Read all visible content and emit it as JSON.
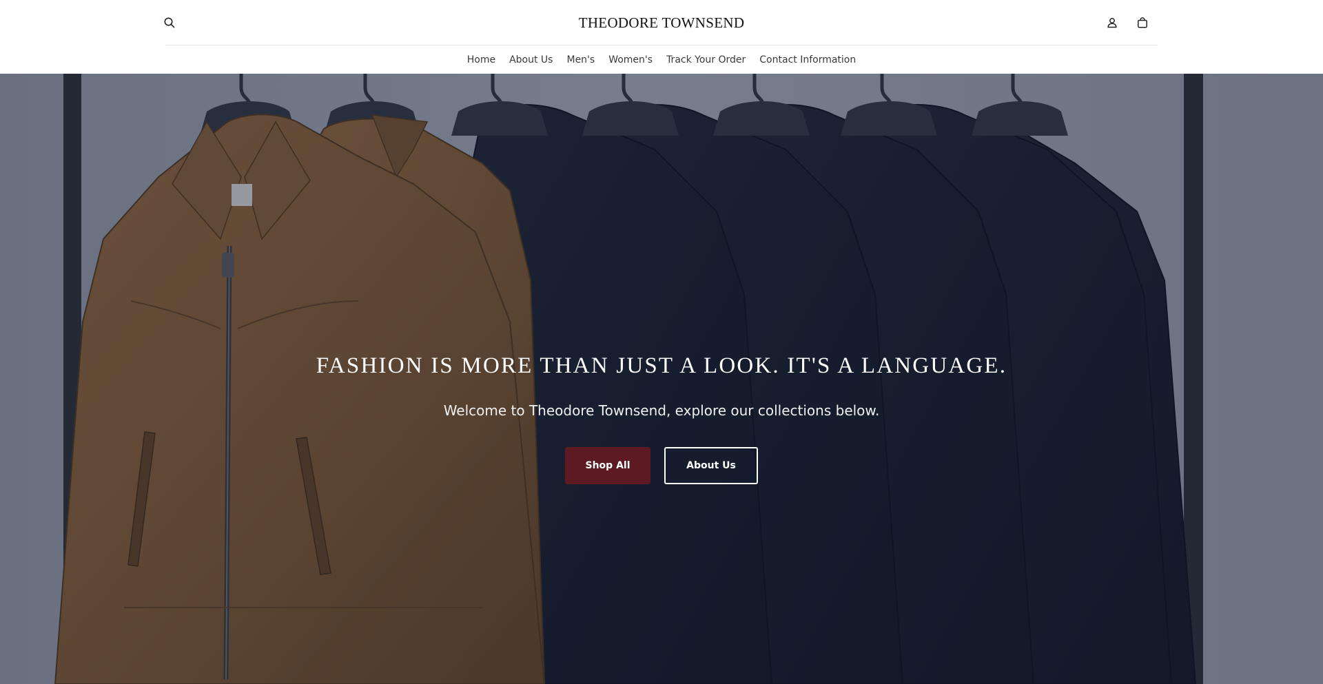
{
  "brand": {
    "name": "THEODORE TOWNSEND"
  },
  "header": {
    "icons": {
      "search": "search-icon",
      "account": "account-icon",
      "cart": "shopping-bag-icon"
    }
  },
  "nav": {
    "items": [
      {
        "label": "Home"
      },
      {
        "label": "About Us"
      },
      {
        "label": "Men's"
      },
      {
        "label": "Women's"
      },
      {
        "label": "Track Your Order"
      },
      {
        "label": "Contact Information"
      }
    ]
  },
  "hero": {
    "title": "FASHION IS MORE THAN JUST A LOOK. IT'S A LANGUAGE.",
    "subtitle": "Welcome to Theodore Townsend, explore our collections below.",
    "primary_button": "Shop All",
    "secondary_button": "About Us"
  },
  "colors": {
    "accent": "#5e1a22",
    "text_dark": "#111111",
    "hero_overlay": "#141c2d"
  }
}
